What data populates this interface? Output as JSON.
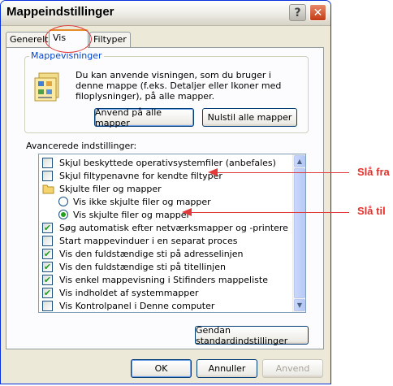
{
  "window": {
    "title": "Mappeindstillinger",
    "help_glyph": "?",
    "close_glyph": "✕"
  },
  "tabs": [
    {
      "label": "Generelt",
      "active": false
    },
    {
      "label": "Vis",
      "active": true
    },
    {
      "label": "Filtyper",
      "active": false
    }
  ],
  "folder_views": {
    "legend": "Mappevisninger",
    "description": "Du kan anvende visningen, som du bruger i denne mappe (f.eks. Detaljer eller Ikoner med filoplysninger), på alle mapper.",
    "apply_all_label": "Anvend på alle mapper",
    "reset_all_label": "Nulstil alle mapper"
  },
  "advanced": {
    "label": "Avancerede indstillinger:",
    "items": [
      {
        "type": "checkbox",
        "label": "Skjul beskyttede operativsystemfiler (anbefales)",
        "checked": false
      },
      {
        "type": "checkbox",
        "label": "Skjul filtypenavne for kendte filtyper",
        "checked": false
      },
      {
        "type": "folder",
        "label": "Skjulte filer og mapper"
      },
      {
        "type": "radio",
        "label": "Vis ikke skjulte filer og mapper",
        "checked": false
      },
      {
        "type": "radio",
        "label": "Vis skjulte filer og mapper",
        "checked": true
      },
      {
        "type": "checkbox",
        "label": "Søg automatisk efter netværksmapper og -printere",
        "checked": true
      },
      {
        "type": "checkbox",
        "label": "Start mappevinduer i en separat proces",
        "checked": false
      },
      {
        "type": "checkbox",
        "label": "Vis den fuldstændige sti på adresselinjen",
        "checked": true
      },
      {
        "type": "checkbox",
        "label": "Vis den fuldstændige sti på titellinjen",
        "checked": true
      },
      {
        "type": "checkbox",
        "label": "Vis enkel mappevisning i Stifinders mappeliste",
        "checked": true
      },
      {
        "type": "checkbox",
        "label": "Vis indholdet af systemmapper",
        "checked": true
      },
      {
        "type": "checkbox",
        "label": "Vis Kontrolpanel i Denne computer",
        "checked": false
      }
    ],
    "restore_defaults_label": "Gendan standardindstillinger"
  },
  "footer": {
    "ok_label": "OK",
    "cancel_label": "Annuller",
    "apply_label": "Anvend"
  },
  "annotations": {
    "off_label": "Slå fra",
    "on_label": "Slå til",
    "color": "#e8302a"
  }
}
